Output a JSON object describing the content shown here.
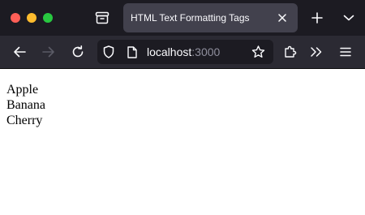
{
  "browser": {
    "tab": {
      "title": "HTML Text Formatting Tags"
    },
    "url": {
      "host": "localhost",
      "port": ":3000"
    }
  },
  "page": {
    "lines": [
      "Apple",
      "Banana",
      "Cherry"
    ]
  },
  "colors": {
    "tab_bar_bg": "#1c1b22",
    "active_tab_bg": "#42414d",
    "toolbar_bg": "#2b2a33",
    "url_field_bg": "#1c1b22",
    "icon": "#fbfbfe",
    "icon_disabled": "#5b5b66",
    "close_dot": "#ff5f57",
    "minimize_dot": "#febc2e",
    "maximize_dot": "#28c840"
  },
  "icons": [
    "close-window",
    "minimize-window",
    "maximize-window",
    "tab-list",
    "close-tab",
    "new-tab",
    "list-all-tabs",
    "back",
    "forward",
    "reload",
    "tracking-protection-shield",
    "page-info",
    "bookmark-star",
    "extensions",
    "overflow-chevrons",
    "app-menu"
  ]
}
